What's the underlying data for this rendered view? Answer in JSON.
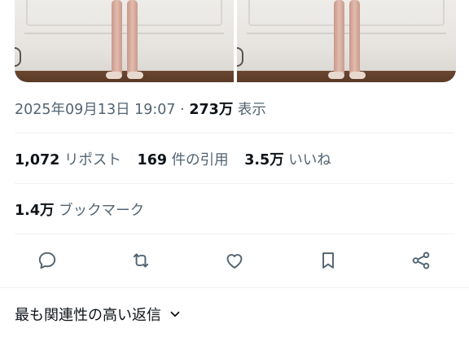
{
  "tweet": {
    "timestamp": "2025年09月13日 19:07",
    "separator": "·",
    "views_count": "273万",
    "views_label": "表示"
  },
  "stats": {
    "reposts_count": "1,072",
    "reposts_label": "リポスト",
    "quotes_count": "169",
    "quotes_label": "件の引用",
    "likes_count": "3.5万",
    "likes_label": "いいね"
  },
  "bookmarks": {
    "count": "1.4万",
    "label": "ブックマーク"
  },
  "actions": {
    "icons": [
      "reply-icon",
      "retweet-icon",
      "like-icon",
      "bookmark-icon",
      "share-icon"
    ]
  },
  "replies": {
    "sort_label": "最も関連性の高い返信"
  },
  "colors": {
    "text_primary": "#0f1419",
    "text_secondary": "#536471",
    "divider": "#eff3f4"
  }
}
